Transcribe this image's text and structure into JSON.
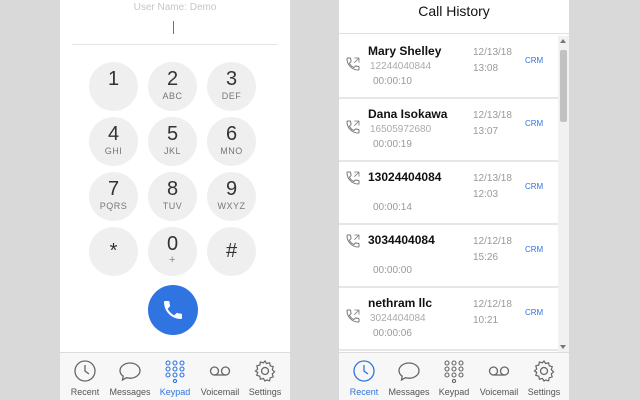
{
  "keypad": {
    "username_label": "User Name: Demo",
    "keys": [
      {
        "digit": "1",
        "letters": ""
      },
      {
        "digit": "2",
        "letters": "ABC"
      },
      {
        "digit": "3",
        "letters": "DEF"
      },
      {
        "digit": "4",
        "letters": "GHI"
      },
      {
        "digit": "5",
        "letters": "JKL"
      },
      {
        "digit": "6",
        "letters": "MNO"
      },
      {
        "digit": "7",
        "letters": "PQRS"
      },
      {
        "digit": "8",
        "letters": "TUV"
      },
      {
        "digit": "9",
        "letters": "WXYZ"
      },
      {
        "digit": "*",
        "letters": ""
      },
      {
        "digit": "0",
        "letters": "+"
      },
      {
        "digit": "#",
        "letters": ""
      }
    ],
    "call_icon": "phone-icon"
  },
  "history": {
    "title": "Call History",
    "calls": [
      {
        "name": "Mary Shelley",
        "number": "12244040844",
        "duration": "00:00:10",
        "date": "12/13/18",
        "time": "13:08",
        "crm": "CRM"
      },
      {
        "name": "Dana Isokawa",
        "number": "16505972680",
        "duration": "00:00:19",
        "date": "12/13/18",
        "time": "13:07",
        "crm": "CRM"
      },
      {
        "name": "13024404084",
        "number": "",
        "duration": "00:00:14",
        "date": "12/13/18",
        "time": "12:03",
        "crm": "CRM"
      },
      {
        "name": "3034404084",
        "number": "",
        "duration": "00:00:00",
        "date": "12/12/18",
        "time": "15:26",
        "crm": "CRM"
      },
      {
        "name": "nethram llc",
        "number": "3024404084",
        "duration": "00:00:06",
        "date": "12/12/18",
        "time": "10:21",
        "crm": "CRM"
      }
    ]
  },
  "tabs": {
    "recent": "Recent",
    "messages": "Messages",
    "keypad": "Keypad",
    "voicemail": "Voicemail",
    "settings": "Settings"
  },
  "colors": {
    "accent": "#2f74e0",
    "key_bg": "#efefef",
    "page_bg": "#d9d9d9"
  }
}
